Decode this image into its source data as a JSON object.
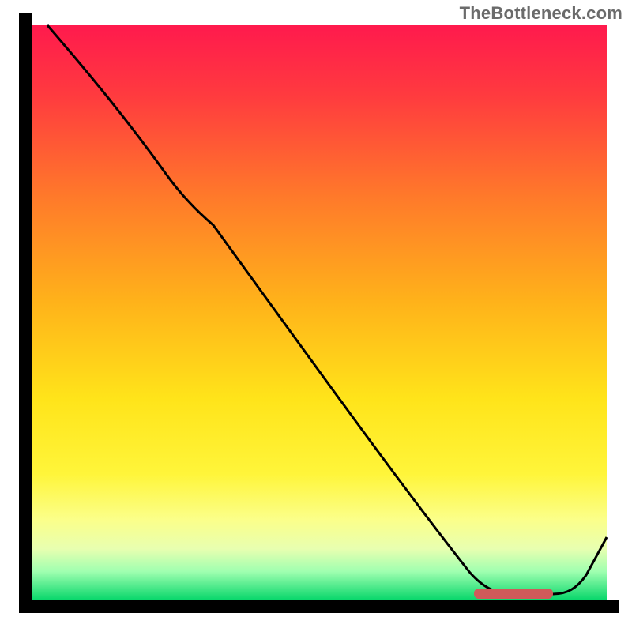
{
  "watermark": "TheBottleneck.com",
  "colors": {
    "gradient_top": "#ff1a4d",
    "gradient_mid1": "#ff7a2a",
    "gradient_mid2": "#ffe41a",
    "gradient_low": "#fbff8a",
    "gradient_bottom": "#06d66a",
    "axis": "#000000",
    "curve": "#000000",
    "marker": "#d05a5a"
  },
  "chart_data": {
    "type": "line",
    "title": "",
    "xlabel": "",
    "ylabel": "",
    "xlim": [
      0,
      100
    ],
    "ylim": [
      0,
      100
    ],
    "grid": false,
    "legend": false,
    "x": [
      0,
      10,
      20,
      30,
      40,
      50,
      60,
      70,
      78,
      82,
      88,
      92,
      100
    ],
    "values": [
      100,
      90,
      78,
      70,
      55,
      42,
      30,
      16,
      4,
      0,
      0,
      2,
      11
    ],
    "notes": "Axes carry no tick labels in the image; x and y are normalized to 0-100. Curve descends from top-left, has a slight knee around x≈25, reaches a flat minimum around x≈80-90, then rises toward the right edge.",
    "optimal_range_x": [
      80,
      93
    ],
    "optimal_range_marker_color": "#d05a5a",
    "background_gradient_meaning": "Red (top) = high bottleneck, Green (bottom) = no bottleneck"
  }
}
